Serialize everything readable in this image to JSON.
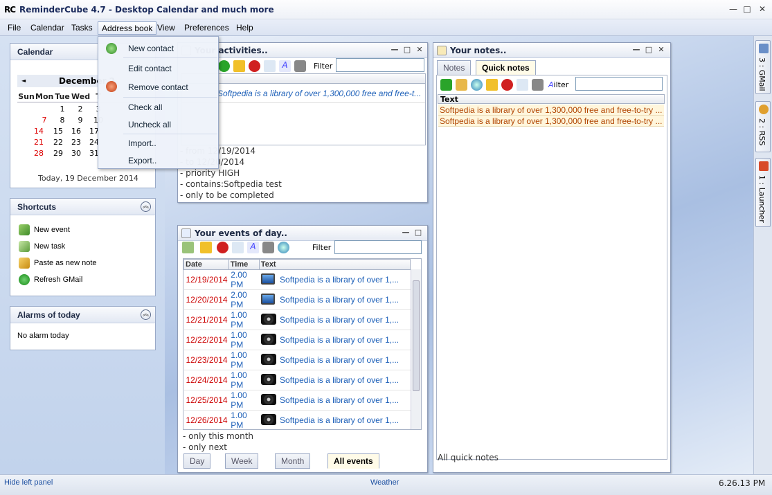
{
  "window": {
    "logo": "RC",
    "title": "ReminderCube 4.7 - Desktop Calendar and much more",
    "min": "—",
    "max": "□",
    "close": "✕"
  },
  "menu": [
    "File",
    "Calendar",
    "Tasks",
    "Address book",
    "View",
    "Preferences",
    "Help"
  ],
  "address_menu": [
    "New contact",
    "Edit contact",
    "Remove contact",
    "Check all",
    "Uncheck all",
    "Import..",
    "Export.."
  ],
  "calendar": {
    "title": "Calendar",
    "month": "December 2",
    "prev": "◄",
    "daynames": [
      "Sun",
      "Mon",
      "Tue",
      "Wed",
      "T"
    ],
    "weeks": [
      [
        "",
        "1",
        "2",
        "3"
      ],
      [
        "7",
        "8",
        "9",
        "10"
      ],
      [
        "14",
        "15",
        "16",
        "17"
      ],
      [
        "21",
        "22",
        "23",
        "24"
      ],
      [
        "28",
        "29",
        "30",
        "31"
      ]
    ],
    "today": "Today, 19 December 2014"
  },
  "shortcuts": {
    "title": "Shortcuts",
    "collapse": "︽",
    "items": [
      "New event",
      "New task",
      "Paste as new note",
      "Refresh GMail"
    ]
  },
  "alarms": {
    "title": "Alarms of today",
    "collapse": "︽",
    "text": "No alarm today"
  },
  "activities": {
    "title": "Your activities..",
    "filter_label": "Filter",
    "row_text": "Softpedia is a library of over 1,300,000 free and free-t...",
    "criteria": [
      "- from 12/19/2014",
      "- to 12/20/2014",
      "- priority HIGH",
      "- contains:Softpedia test",
      "- only to be completed"
    ]
  },
  "events": {
    "title": "Your events of day..",
    "filter_label": "Filter",
    "columns": [
      "Date",
      "Time",
      "Text"
    ],
    "rows": [
      {
        "date": "12/19/2014",
        "time": "2.00 PM",
        "icon": "monitor",
        "text": "Softpedia is a library of over 1,..."
      },
      {
        "date": "12/20/2014",
        "time": "2.00 PM",
        "icon": "monitor",
        "text": "Softpedia is a library of over 1,..."
      },
      {
        "date": "12/21/2014",
        "time": "1.00 PM",
        "icon": "camera",
        "text": "Softpedia is a library of over 1,..."
      },
      {
        "date": "12/22/2014",
        "time": "1.00 PM",
        "icon": "camera",
        "text": "Softpedia is a library of over 1,..."
      },
      {
        "date": "12/23/2014",
        "time": "1.00 PM",
        "icon": "camera",
        "text": "Softpedia is a library of over 1,..."
      },
      {
        "date": "12/24/2014",
        "time": "1.00 PM",
        "icon": "camera",
        "text": "Softpedia is a library of over 1,..."
      },
      {
        "date": "12/25/2014",
        "time": "1.00 PM",
        "icon": "camera",
        "text": "Softpedia is a library of over 1,..."
      },
      {
        "date": "12/26/2014",
        "time": "1.00 PM",
        "icon": "camera",
        "text": "Softpedia is a library of over 1,..."
      }
    ],
    "criteria": [
      "- only this month",
      "- only next"
    ],
    "tabs": [
      "Day",
      "Week",
      "Month",
      "All events"
    ]
  },
  "notes": {
    "title": "Your notes..",
    "tabs": [
      "Notes",
      "Quick notes"
    ],
    "filter_label": "ilter",
    "column": "Text",
    "rows": [
      "Softpedia is a library of over 1,300,000 free and free-to-try ...",
      "Softpedia is a library of over 1,300,000 free and free-to-try ..."
    ],
    "footer": "All quick notes"
  },
  "right_tabs": [
    "3 : GMail",
    "2 : RSS",
    "1 : Launcher"
  ],
  "status": {
    "left": "Hide left panel",
    "center": "Weather",
    "right": "6.26.13 PM"
  },
  "colors": {
    "accent": "#1c5fb8",
    "red": "#cc0000",
    "note": "#b14400"
  }
}
